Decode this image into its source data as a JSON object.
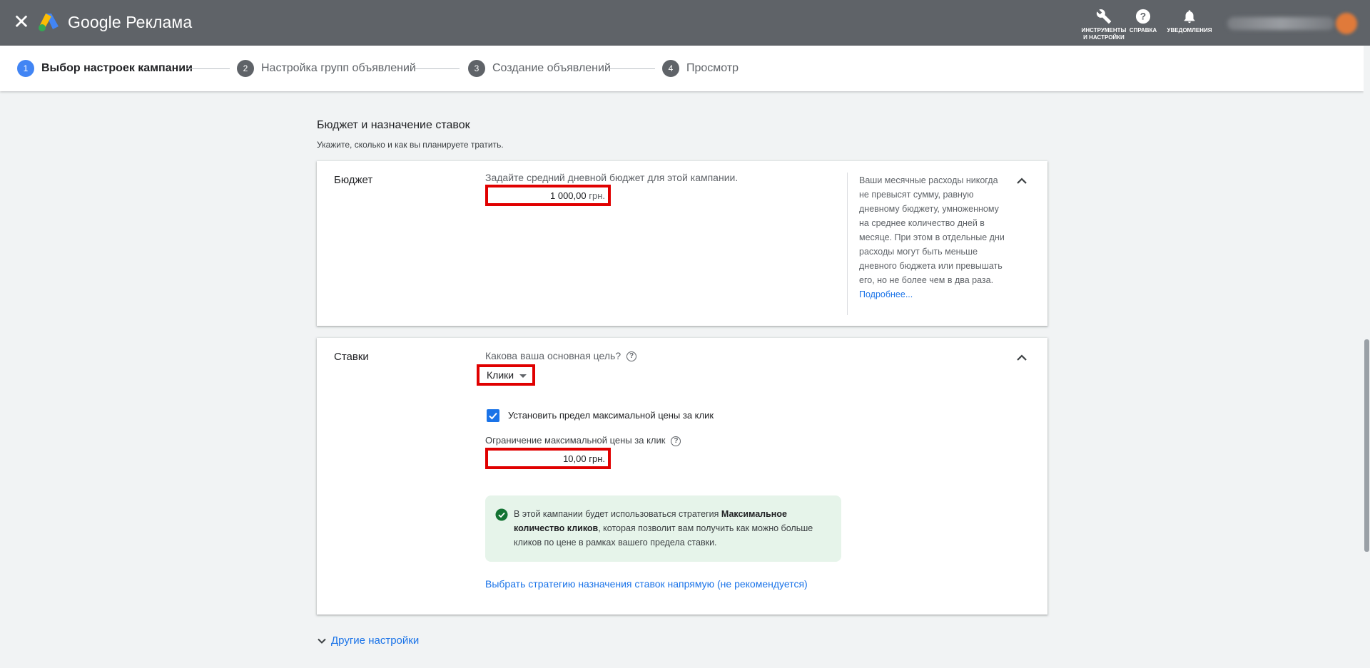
{
  "app": {
    "brand": "Google Реклама"
  },
  "header": {
    "tools_label": "ИНСТРУМЕНТЫ И НАСТРОЙКИ",
    "help_label": "СПРАВКА",
    "notifications_label": "УВЕДОМЛЕНИЯ"
  },
  "stepper": {
    "steps": [
      {
        "num": "1",
        "label": "Выбор настроек кампании"
      },
      {
        "num": "2",
        "label": "Настройка групп объявлений"
      },
      {
        "num": "3",
        "label": "Создание объявлений"
      },
      {
        "num": "4",
        "label": "Просмотр"
      }
    ]
  },
  "section": {
    "title": "Бюджет и назначение ставок",
    "subtitle": "Укажите, сколько и как вы планируете тратить."
  },
  "budget": {
    "label": "Бюджет",
    "hint": "Задайте средний дневной бюджет для этой кампании.",
    "value": "1 000,00",
    "currency": "грн.",
    "note": "Ваши месячные расходы никогда не превысят сумму, равную дневному бюджету, умноженному на среднее количество дней в месяце. При этом в отдельные дни расходы могут быть меньше дневного бюджета или превышать его, но не более чем в два раза.",
    "note_link": "Подробнее..."
  },
  "bids": {
    "label": "Ставки",
    "goal_question": "Какова ваша основная цель?",
    "goal_value": "Клики",
    "limit_checkbox_label": "Установить предел максимальной цены за клик",
    "limit_checked": true,
    "max_cpc_label": "Ограничение максимальной цены за клик",
    "max_cpc_value": "10,00",
    "max_cpc_currency": "грн.",
    "info_prefix": "В этой кампании будет использоваться стратегия ",
    "info_bold": "Максимальное количество кликов",
    "info_suffix": ", которая позволит вам получить как можно больше кликов по цене в рамках вашего предела ставки.",
    "strategy_link": "Выбрать стратегию назначения ставок напрямую (не рекомендуется)"
  },
  "other_settings": "Другие настройки",
  "colors": {
    "header_bg": "#5f6368",
    "accent": "#1a73e8",
    "highlight_border": "#e00000",
    "success_bg": "#e6f4ea",
    "success_icon": "#137333"
  }
}
